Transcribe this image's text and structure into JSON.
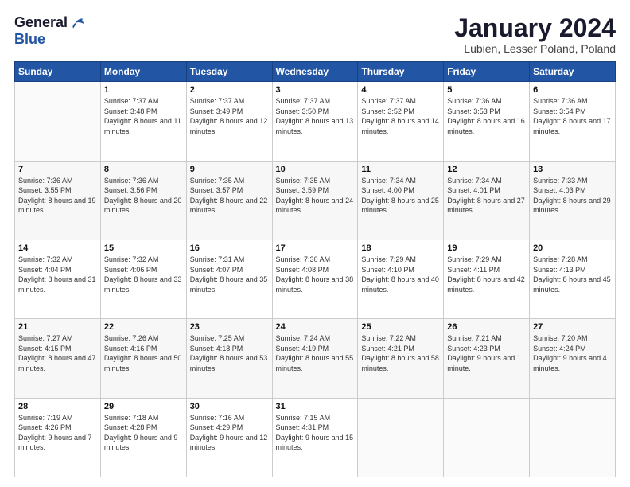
{
  "header": {
    "logo_general": "General",
    "logo_blue": "Blue",
    "title": "January 2024",
    "location": "Lubien, Lesser Poland, Poland"
  },
  "weekdays": [
    "Sunday",
    "Monday",
    "Tuesday",
    "Wednesday",
    "Thursday",
    "Friday",
    "Saturday"
  ],
  "weeks": [
    [
      {
        "day": "",
        "sunrise": "",
        "sunset": "",
        "daylight": ""
      },
      {
        "day": "1",
        "sunrise": "Sunrise: 7:37 AM",
        "sunset": "Sunset: 3:48 PM",
        "daylight": "Daylight: 8 hours and 11 minutes."
      },
      {
        "day": "2",
        "sunrise": "Sunrise: 7:37 AM",
        "sunset": "Sunset: 3:49 PM",
        "daylight": "Daylight: 8 hours and 12 minutes."
      },
      {
        "day": "3",
        "sunrise": "Sunrise: 7:37 AM",
        "sunset": "Sunset: 3:50 PM",
        "daylight": "Daylight: 8 hours and 13 minutes."
      },
      {
        "day": "4",
        "sunrise": "Sunrise: 7:37 AM",
        "sunset": "Sunset: 3:52 PM",
        "daylight": "Daylight: 8 hours and 14 minutes."
      },
      {
        "day": "5",
        "sunrise": "Sunrise: 7:36 AM",
        "sunset": "Sunset: 3:53 PM",
        "daylight": "Daylight: 8 hours and 16 minutes."
      },
      {
        "day": "6",
        "sunrise": "Sunrise: 7:36 AM",
        "sunset": "Sunset: 3:54 PM",
        "daylight": "Daylight: 8 hours and 17 minutes."
      }
    ],
    [
      {
        "day": "7",
        "sunrise": "Sunrise: 7:36 AM",
        "sunset": "Sunset: 3:55 PM",
        "daylight": "Daylight: 8 hours and 19 minutes."
      },
      {
        "day": "8",
        "sunrise": "Sunrise: 7:36 AM",
        "sunset": "Sunset: 3:56 PM",
        "daylight": "Daylight: 8 hours and 20 minutes."
      },
      {
        "day": "9",
        "sunrise": "Sunrise: 7:35 AM",
        "sunset": "Sunset: 3:57 PM",
        "daylight": "Daylight: 8 hours and 22 minutes."
      },
      {
        "day": "10",
        "sunrise": "Sunrise: 7:35 AM",
        "sunset": "Sunset: 3:59 PM",
        "daylight": "Daylight: 8 hours and 24 minutes."
      },
      {
        "day": "11",
        "sunrise": "Sunrise: 7:34 AM",
        "sunset": "Sunset: 4:00 PM",
        "daylight": "Daylight: 8 hours and 25 minutes."
      },
      {
        "day": "12",
        "sunrise": "Sunrise: 7:34 AM",
        "sunset": "Sunset: 4:01 PM",
        "daylight": "Daylight: 8 hours and 27 minutes."
      },
      {
        "day": "13",
        "sunrise": "Sunrise: 7:33 AM",
        "sunset": "Sunset: 4:03 PM",
        "daylight": "Daylight: 8 hours and 29 minutes."
      }
    ],
    [
      {
        "day": "14",
        "sunrise": "Sunrise: 7:32 AM",
        "sunset": "Sunset: 4:04 PM",
        "daylight": "Daylight: 8 hours and 31 minutes."
      },
      {
        "day": "15",
        "sunrise": "Sunrise: 7:32 AM",
        "sunset": "Sunset: 4:06 PM",
        "daylight": "Daylight: 8 hours and 33 minutes."
      },
      {
        "day": "16",
        "sunrise": "Sunrise: 7:31 AM",
        "sunset": "Sunset: 4:07 PM",
        "daylight": "Daylight: 8 hours and 35 minutes."
      },
      {
        "day": "17",
        "sunrise": "Sunrise: 7:30 AM",
        "sunset": "Sunset: 4:08 PM",
        "daylight": "Daylight: 8 hours and 38 minutes."
      },
      {
        "day": "18",
        "sunrise": "Sunrise: 7:29 AM",
        "sunset": "Sunset: 4:10 PM",
        "daylight": "Daylight: 8 hours and 40 minutes."
      },
      {
        "day": "19",
        "sunrise": "Sunrise: 7:29 AM",
        "sunset": "Sunset: 4:11 PM",
        "daylight": "Daylight: 8 hours and 42 minutes."
      },
      {
        "day": "20",
        "sunrise": "Sunrise: 7:28 AM",
        "sunset": "Sunset: 4:13 PM",
        "daylight": "Daylight: 8 hours and 45 minutes."
      }
    ],
    [
      {
        "day": "21",
        "sunrise": "Sunrise: 7:27 AM",
        "sunset": "Sunset: 4:15 PM",
        "daylight": "Daylight: 8 hours and 47 minutes."
      },
      {
        "day": "22",
        "sunrise": "Sunrise: 7:26 AM",
        "sunset": "Sunset: 4:16 PM",
        "daylight": "Daylight: 8 hours and 50 minutes."
      },
      {
        "day": "23",
        "sunrise": "Sunrise: 7:25 AM",
        "sunset": "Sunset: 4:18 PM",
        "daylight": "Daylight: 8 hours and 53 minutes."
      },
      {
        "day": "24",
        "sunrise": "Sunrise: 7:24 AM",
        "sunset": "Sunset: 4:19 PM",
        "daylight": "Daylight: 8 hours and 55 minutes."
      },
      {
        "day": "25",
        "sunrise": "Sunrise: 7:22 AM",
        "sunset": "Sunset: 4:21 PM",
        "daylight": "Daylight: 8 hours and 58 minutes."
      },
      {
        "day": "26",
        "sunrise": "Sunrise: 7:21 AM",
        "sunset": "Sunset: 4:23 PM",
        "daylight": "Daylight: 9 hours and 1 minute."
      },
      {
        "day": "27",
        "sunrise": "Sunrise: 7:20 AM",
        "sunset": "Sunset: 4:24 PM",
        "daylight": "Daylight: 9 hours and 4 minutes."
      }
    ],
    [
      {
        "day": "28",
        "sunrise": "Sunrise: 7:19 AM",
        "sunset": "Sunset: 4:26 PM",
        "daylight": "Daylight: 9 hours and 7 minutes."
      },
      {
        "day": "29",
        "sunrise": "Sunrise: 7:18 AM",
        "sunset": "Sunset: 4:28 PM",
        "daylight": "Daylight: 9 hours and 9 minutes."
      },
      {
        "day": "30",
        "sunrise": "Sunrise: 7:16 AM",
        "sunset": "Sunset: 4:29 PM",
        "daylight": "Daylight: 9 hours and 12 minutes."
      },
      {
        "day": "31",
        "sunrise": "Sunrise: 7:15 AM",
        "sunset": "Sunset: 4:31 PM",
        "daylight": "Daylight: 9 hours and 15 minutes."
      },
      {
        "day": "",
        "sunrise": "",
        "sunset": "",
        "daylight": ""
      },
      {
        "day": "",
        "sunrise": "",
        "sunset": "",
        "daylight": ""
      },
      {
        "day": "",
        "sunrise": "",
        "sunset": "",
        "daylight": ""
      }
    ]
  ]
}
